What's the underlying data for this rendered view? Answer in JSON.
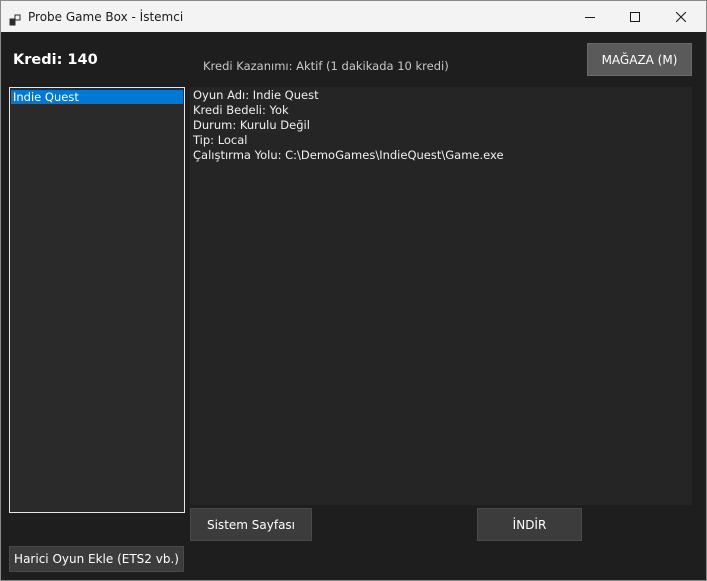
{
  "window": {
    "title": "Probe Game Box - İstemci",
    "icon": "app-window-icon",
    "controls": [
      "minimize-icon",
      "maximize-icon",
      "close-icon"
    ]
  },
  "header": {
    "credit_label": "Kredi: 140",
    "earn_status": "Kredi Kazanımı: Aktif (1 dakikada 10 kredi)",
    "store_button": "MAĞAZA (M)"
  },
  "game_list": {
    "items": [
      {
        "label": "Indie Quest",
        "selected": true
      }
    ]
  },
  "details": {
    "lines": [
      "Oyun Adı: Indie Quest",
      "Kredi Bedeli: Yok",
      "Durum: Kurulu Değil",
      "Tip: Local",
      "Çalıştırma Yolu: C:\\DemoGames\\IndieQuest\\Game.exe"
    ]
  },
  "actions": {
    "system_page_button": "Sistem Sayfası",
    "download_button": "İNDİR",
    "add_external_button": "Harici Oyun Ekle (ETS2 vb.)"
  },
  "colors": {
    "background": "#1e1e1e",
    "panel": "#252525",
    "selection": "#0078d7",
    "button": "#3c3c3c",
    "store_button": "#5a5a5a"
  }
}
